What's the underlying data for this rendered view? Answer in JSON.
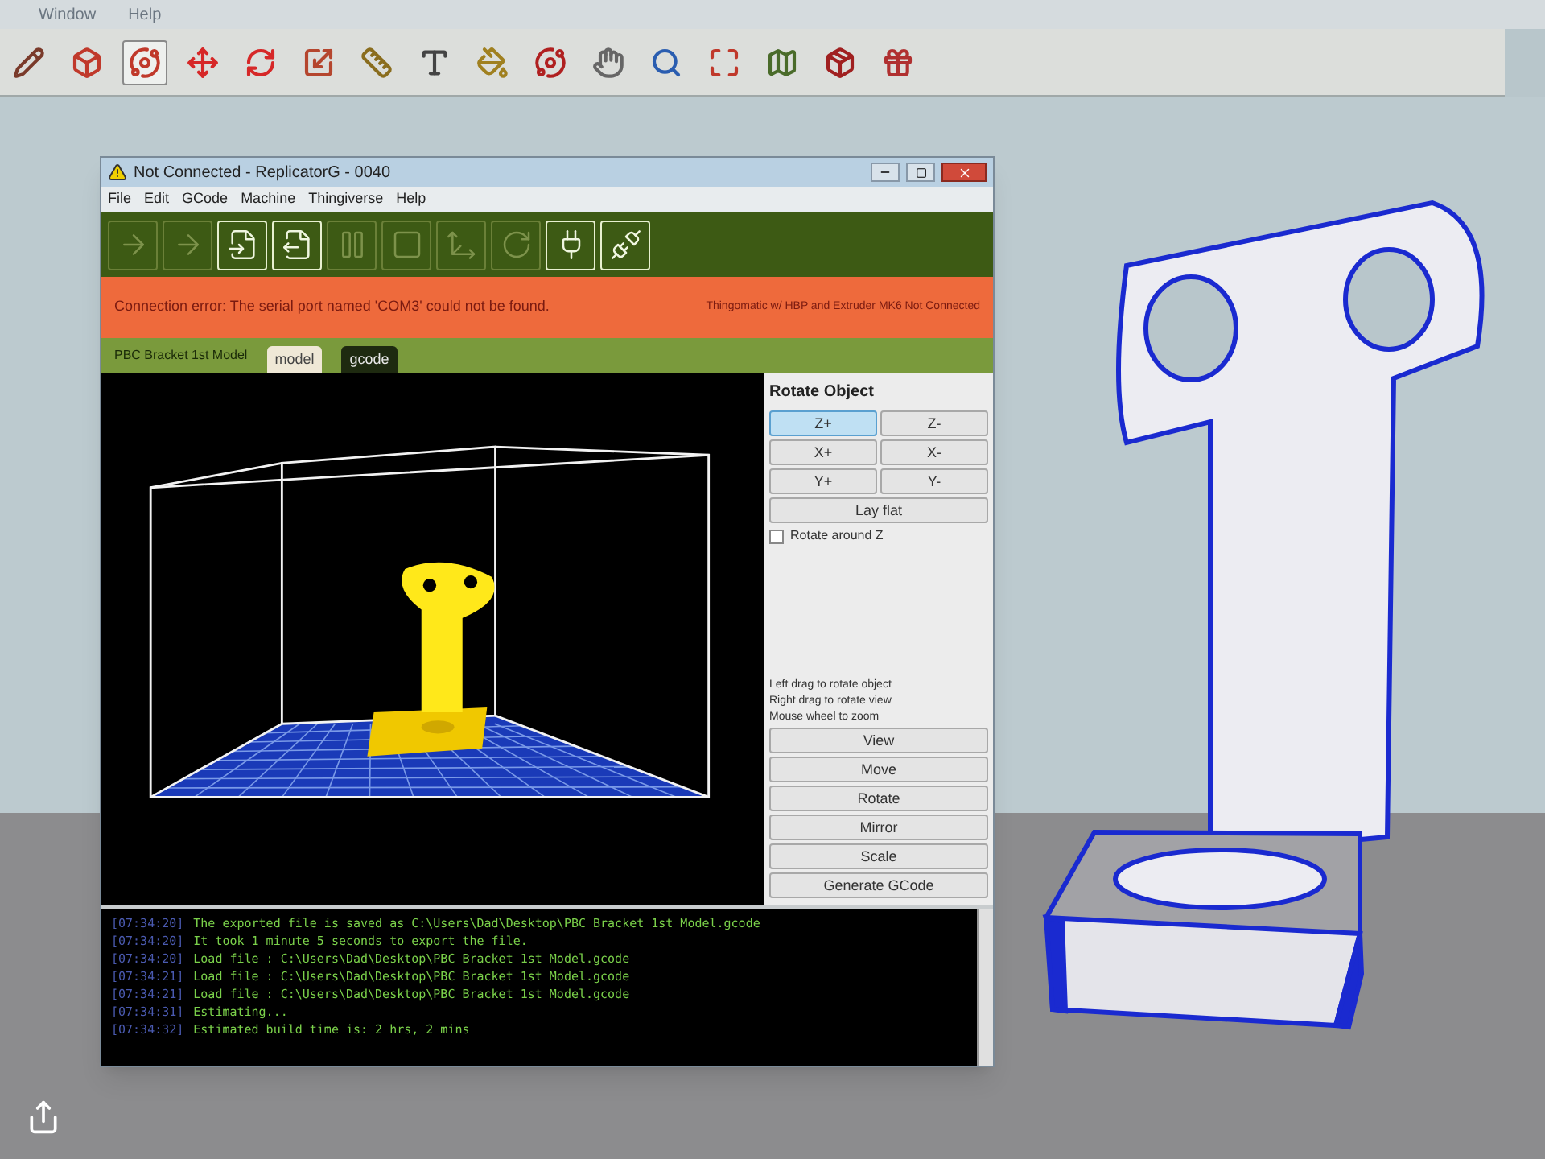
{
  "background_app": {
    "menu": [
      "Window",
      "Help"
    ],
    "toolbar_tools": [
      {
        "selected": false
      },
      {
        "selected": false
      },
      {
        "selected": true
      },
      {
        "selected": false
      },
      {
        "selected": false
      },
      {
        "selected": false
      },
      {
        "selected": false
      },
      {
        "selected": false
      },
      {
        "selected": false
      },
      {
        "selected": false
      },
      {
        "selected": false
      },
      {
        "selected": false
      },
      {
        "selected": false
      },
      {
        "selected": false
      },
      {
        "selected": false
      },
      {
        "selected": false
      }
    ]
  },
  "window": {
    "title": "Not Connected - ReplicatorG - 0040",
    "menu": [
      "File",
      "Edit",
      "GCode",
      "Machine",
      "Thingiverse",
      "Help"
    ],
    "toolbar": [
      {
        "disabled": true
      },
      {
        "disabled": true
      },
      {
        "disabled": false
      },
      {
        "disabled": false
      },
      {
        "disabled": true
      },
      {
        "disabled": true
      },
      {
        "disabled": true
      },
      {
        "disabled": true
      },
      {
        "disabled": false
      },
      {
        "disabled": false
      }
    ],
    "status_message": "Connection error: The serial port named 'COM3' could not be found.",
    "machine_status": "Thingomatic w/ HBP and Extruder MK6 Not Connected",
    "file_name": "PBC Bracket 1st Model",
    "tabs": [
      {
        "label": "model",
        "selected": true
      },
      {
        "label": "gcode",
        "selected": false
      }
    ],
    "panel": {
      "title": "Rotate Object",
      "rotate_buttons": [
        {
          "label": "Z+",
          "selected": true
        },
        {
          "label": "Z-",
          "selected": false
        },
        {
          "label": "X+",
          "selected": false
        },
        {
          "label": "X-",
          "selected": false
        },
        {
          "label": "Y+",
          "selected": false
        },
        {
          "label": "Y-",
          "selected": false
        }
      ],
      "lay_flat": "Lay flat",
      "checkbox": {
        "label": "Rotate around Z",
        "checked": false
      },
      "hints": [
        "Left drag to rotate object",
        "Right drag to rotate view",
        "Mouse wheel to zoom"
      ],
      "mode_buttons": [
        "View",
        "Move",
        "Rotate",
        "Mirror",
        "Scale",
        "Generate GCode"
      ]
    },
    "console": [
      {
        "time": "[07:34:20]",
        "message": "The exported file is saved as C:\\Users\\Dad\\Desktop\\PBC Bracket 1st Model.gcode"
      },
      {
        "time": "[07:34:20]",
        "message": "It took 1 minute 5 seconds to export the file."
      },
      {
        "time": "[07:34:20]",
        "message": "Load file : C:\\Users\\Dad\\Desktop\\PBC Bracket 1st Model.gcode"
      },
      {
        "time": "[07:34:21]",
        "message": "Load file : C:\\Users\\Dad\\Desktop\\PBC Bracket 1st Model.gcode"
      },
      {
        "time": "[07:34:21]",
        "message": "Load file : C:\\Users\\Dad\\Desktop\\PBC Bracket 1st Model.gcode"
      },
      {
        "time": "[07:34:31]",
        "message": "Estimating..."
      },
      {
        "time": "[07:34:32]",
        "message": "Estimated build time is: 2 hrs, 2 mins"
      }
    ]
  }
}
